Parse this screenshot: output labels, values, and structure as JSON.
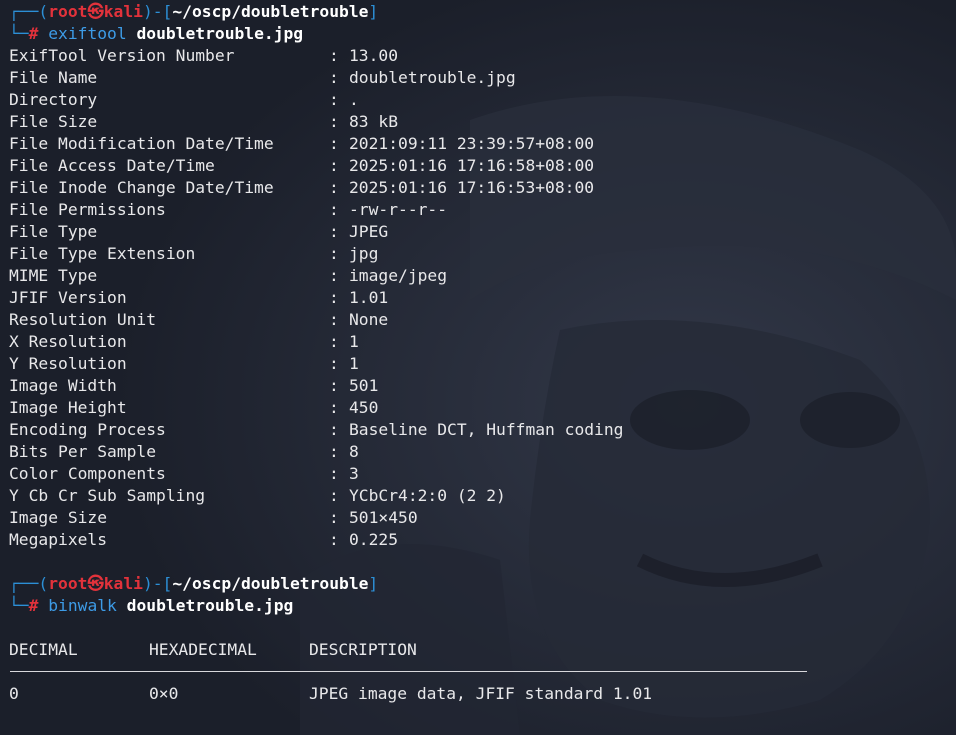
{
  "colors": {
    "background": "#1b1f2a",
    "prompt_frame": "#2c8fd6",
    "prompt_user": "#e2323b",
    "command": "#3d9be6",
    "text": "#e8e8ea"
  },
  "prompt1": {
    "open": "┌──(",
    "user": "root",
    "at_icon": "㉿",
    "host": "kali",
    "mid": ")-[",
    "path": "~/oscp/doubletrouble",
    "close": "]",
    "line2_prefix": "└─",
    "hash": "#",
    "command": "exiftool",
    "argument": "doubletrouble.jpg"
  },
  "exif": [
    {
      "key": "ExifTool Version Number",
      "value": "13.00"
    },
    {
      "key": "File Name",
      "value": "doubletrouble.jpg"
    },
    {
      "key": "Directory",
      "value": "."
    },
    {
      "key": "File Size",
      "value": "83 kB"
    },
    {
      "key": "File Modification Date/Time",
      "value": "2021:09:11 23:39:57+08:00"
    },
    {
      "key": "File Access Date/Time",
      "value": "2025:01:16 17:16:58+08:00"
    },
    {
      "key": "File Inode Change Date/Time",
      "value": "2025:01:16 17:16:53+08:00"
    },
    {
      "key": "File Permissions",
      "value": "-rw-r--r--"
    },
    {
      "key": "File Type",
      "value": "JPEG"
    },
    {
      "key": "File Type Extension",
      "value": "jpg"
    },
    {
      "key": "MIME Type",
      "value": "image/jpeg"
    },
    {
      "key": "JFIF Version",
      "value": "1.01"
    },
    {
      "key": "Resolution Unit",
      "value": "None"
    },
    {
      "key": "X Resolution",
      "value": "1"
    },
    {
      "key": "Y Resolution",
      "value": "1"
    },
    {
      "key": "Image Width",
      "value": "501"
    },
    {
      "key": "Image Height",
      "value": "450"
    },
    {
      "key": "Encoding Process",
      "value": "Baseline DCT, Huffman coding"
    },
    {
      "key": "Bits Per Sample",
      "value": "8"
    },
    {
      "key": "Color Components",
      "value": "3"
    },
    {
      "key": "Y Cb Cr Sub Sampling",
      "value": "YCbCr4:2:0 (2 2)"
    },
    {
      "key": "Image Size",
      "value": "501×450"
    },
    {
      "key": "Megapixels",
      "value": "0.225"
    }
  ],
  "separator": ":",
  "prompt2": {
    "open": "┌──(",
    "user": "root",
    "at_icon": "㉿",
    "host": "kali",
    "mid": ")-[",
    "path": "~/oscp/doubletrouble",
    "close": "]",
    "line2_prefix": "└─",
    "hash": "#",
    "command": "binwalk",
    "argument": "doubletrouble.jpg"
  },
  "binwalk": {
    "headers": [
      "DECIMAL",
      "HEXADECIMAL",
      "DESCRIPTION"
    ],
    "rows": [
      [
        "0",
        "0×0",
        "JPEG image data, JFIF standard 1.01"
      ]
    ]
  }
}
